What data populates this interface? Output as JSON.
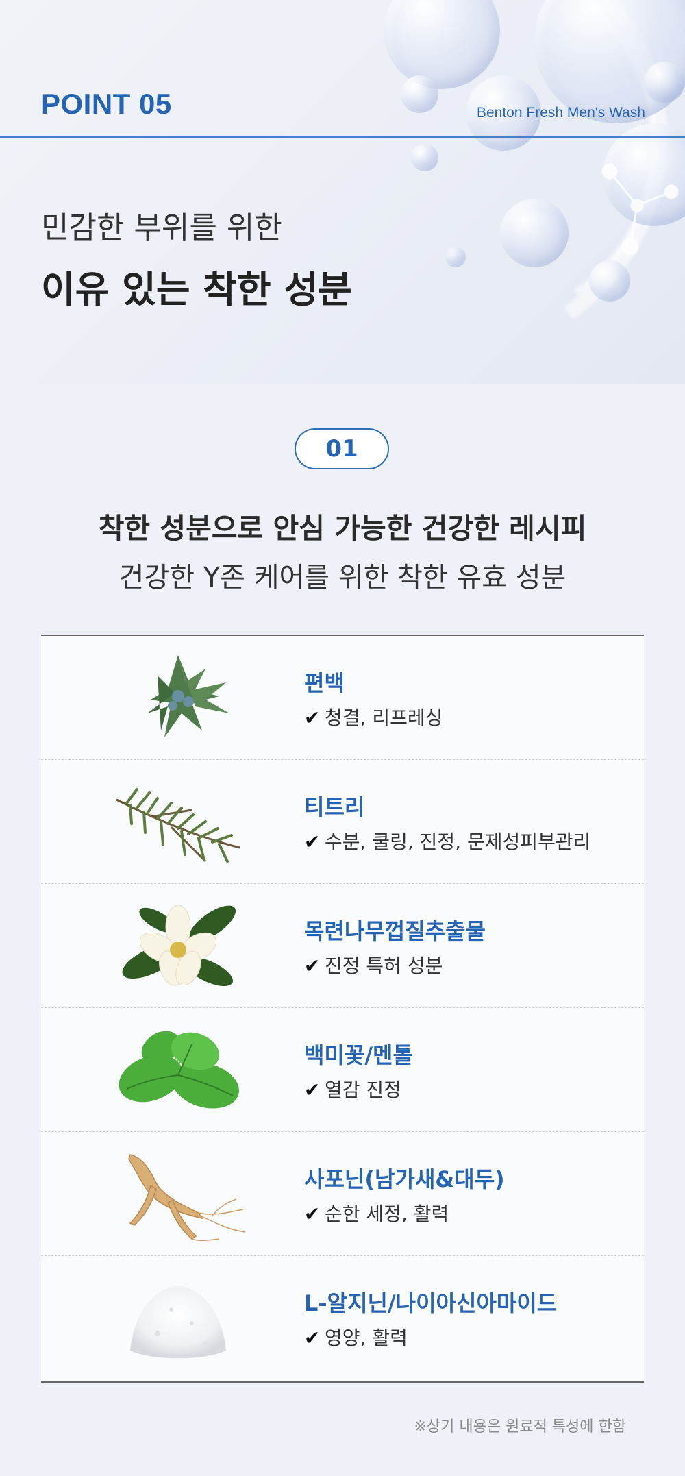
{
  "header": {
    "point_label": "POINT 05",
    "brand": "Benton Fresh Men's Wash"
  },
  "hero": {
    "subtitle": "민감한 부위를 위한",
    "title": "이유 있는 착한 성분"
  },
  "section": {
    "badge": "01",
    "title": "착한 성분으로 안심 가능한 건강한 레시피",
    "subtitle": "건강한 Y존 케어를 위한 착한 유효 성분"
  },
  "check_mark": "✔",
  "ingredients": [
    {
      "name": "편백",
      "desc": "청결, 리프레싱",
      "icon": "cypress-leaf-icon"
    },
    {
      "name": "티트리",
      "desc": "수분, 쿨링, 진정, 문제성피부관리",
      "icon": "tea-tree-icon"
    },
    {
      "name": "목련나무껍질추출물",
      "desc": "진정 특허 성분",
      "icon": "magnolia-flower-icon"
    },
    {
      "name": "백미꽃/멘톨",
      "desc": "열감 진정",
      "icon": "mint-leaf-icon"
    },
    {
      "name": "사포닌(남가새&대두)",
      "desc": "순한 세정, 활력",
      "icon": "ginseng-root-icon"
    },
    {
      "name": "L-알지닌/나이아신아마이드",
      "desc": "영양, 활력",
      "icon": "white-powder-icon"
    }
  ],
  "footnote": "※상기 내용은 원료적 특성에 한함",
  "colors": {
    "accent": "#2563b4",
    "background": "#eef1f7",
    "table_bg": "#fafbfd"
  }
}
